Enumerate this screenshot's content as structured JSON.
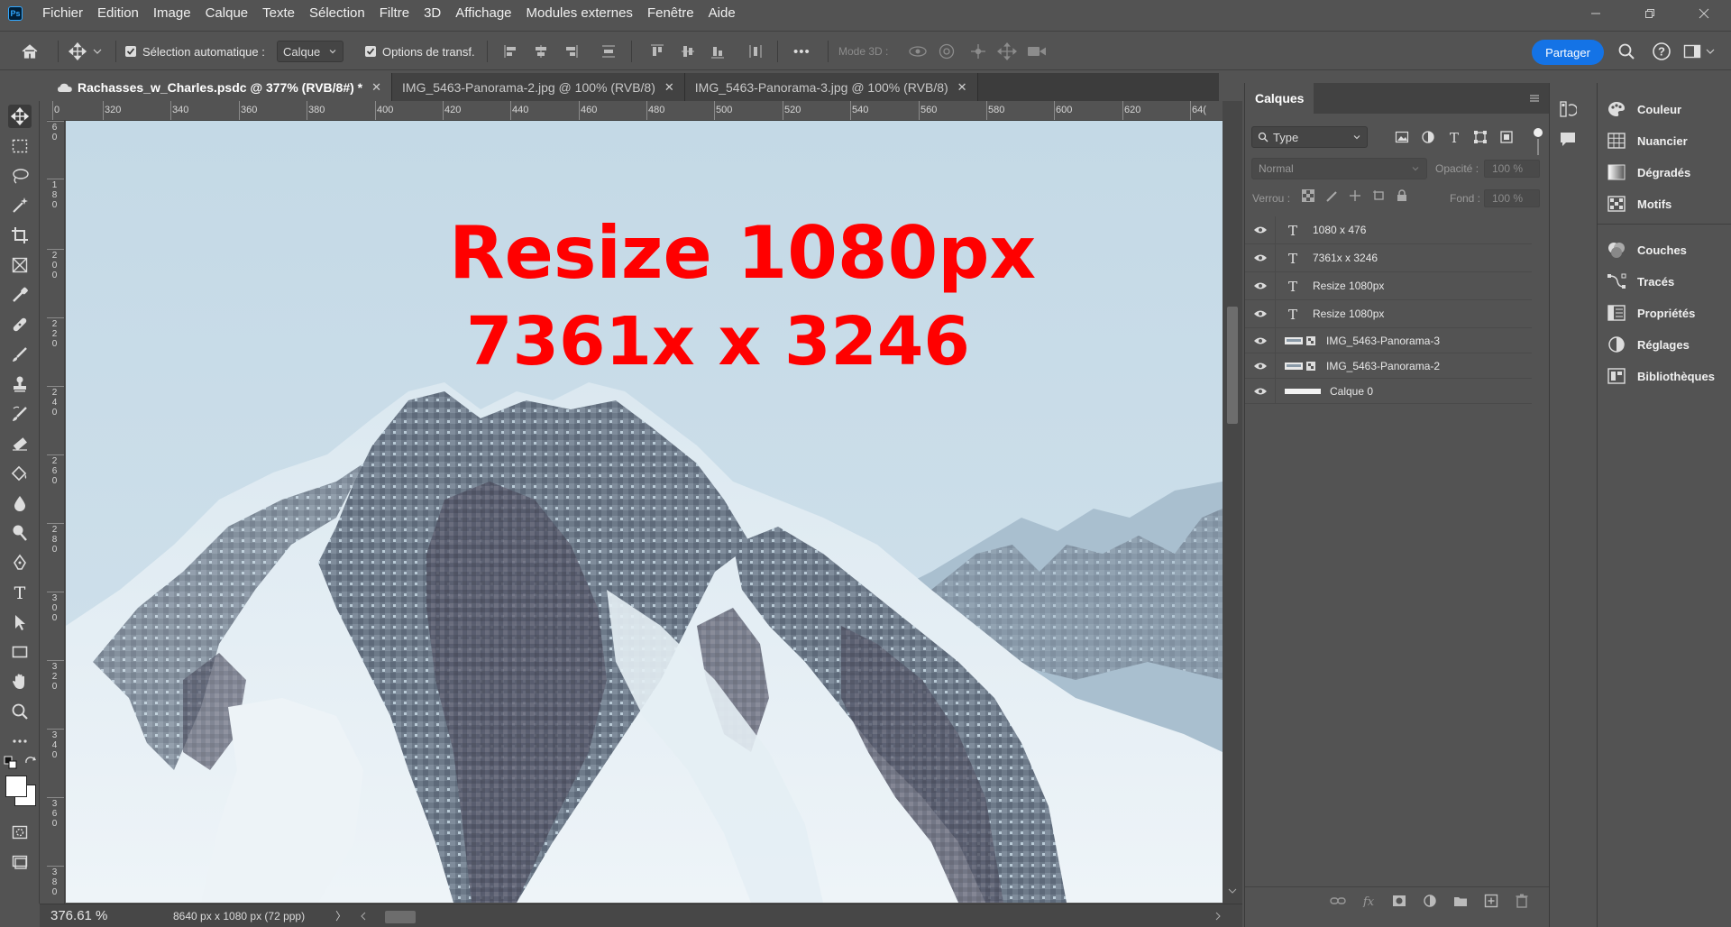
{
  "app": {
    "logo": "Ps",
    "menu": [
      "Fichier",
      "Edition",
      "Image",
      "Calque",
      "Texte",
      "Sélection",
      "Filtre",
      "3D",
      "Affichage",
      "Modules externes",
      "Fenêtre",
      "Aide"
    ]
  },
  "options_bar": {
    "auto_select_label": "Sélection automatique :",
    "auto_select_checked": true,
    "auto_select_target": "Calque",
    "transform_label": "Options de transf.",
    "transform_checked": true,
    "more": "•••",
    "mode3d_label": "Mode 3D :",
    "share_label": "Partager"
  },
  "tabs": [
    {
      "label": "Rachasses_w_Charles.psdc @ 377% (RVB/8#) *",
      "active": true
    },
    {
      "label": "IMG_5463-Panorama-2.jpg @ 100% (RVB/8)",
      "active": false
    },
    {
      "label": "IMG_5463-Panorama-3.jpg @ 100% (RVB/8)",
      "active": false
    }
  ],
  "rulers": {
    "horizontal": [
      "0",
      "320",
      "340",
      "360",
      "380",
      "400",
      "420",
      "440",
      "460",
      "480",
      "500",
      "520",
      "540",
      "560",
      "580",
      "600",
      "620",
      "64("
    ],
    "vertical": [
      "6\n0",
      "1\n8\n0",
      "2\n0\n0",
      "2\n2\n0",
      "2\n4\n0",
      "2\n6\n0",
      "2\n8\n0",
      "3\n0\n0",
      "3\n2\n0",
      "3\n4\n0",
      "3\n6\n0",
      "3\n8\n0"
    ]
  },
  "canvas": {
    "line1": "Resize 1080px",
    "line2": "7361x x 3246",
    "text_color": "#ff0000"
  },
  "status": {
    "zoom": "376.61 %",
    "doc_info": "8640 px x 1080 px (72 ppp)",
    "arrow": "〉"
  },
  "layers_panel": {
    "title": "Calques",
    "filter": "Type",
    "blend_mode": "Normal",
    "opacity_label": "Opacité :",
    "opacity_value": "100 %",
    "lock_label": "Verrou :",
    "fill_label": "Fond :",
    "fill_value": "100 %",
    "layers": [
      {
        "name": "1080 x 476",
        "kind": "text"
      },
      {
        "name": "7361x x 3246",
        "kind": "text"
      },
      {
        "name": "Resize 1080px",
        "kind": "text"
      },
      {
        "name": "Resize 1080px",
        "kind": "text"
      },
      {
        "name": "IMG_5463-Panorama-3",
        "kind": "smart"
      },
      {
        "name": "IMG_5463-Panorama-2",
        "kind": "smart"
      },
      {
        "name": "Calque 0",
        "kind": "pixel"
      }
    ]
  },
  "dock": {
    "items": [
      "Couleur",
      "Nuancier",
      "Dégradés",
      "Motifs",
      "Couches",
      "Tracés",
      "Propriétés",
      "Réglages",
      "Bibliothèques"
    ]
  }
}
